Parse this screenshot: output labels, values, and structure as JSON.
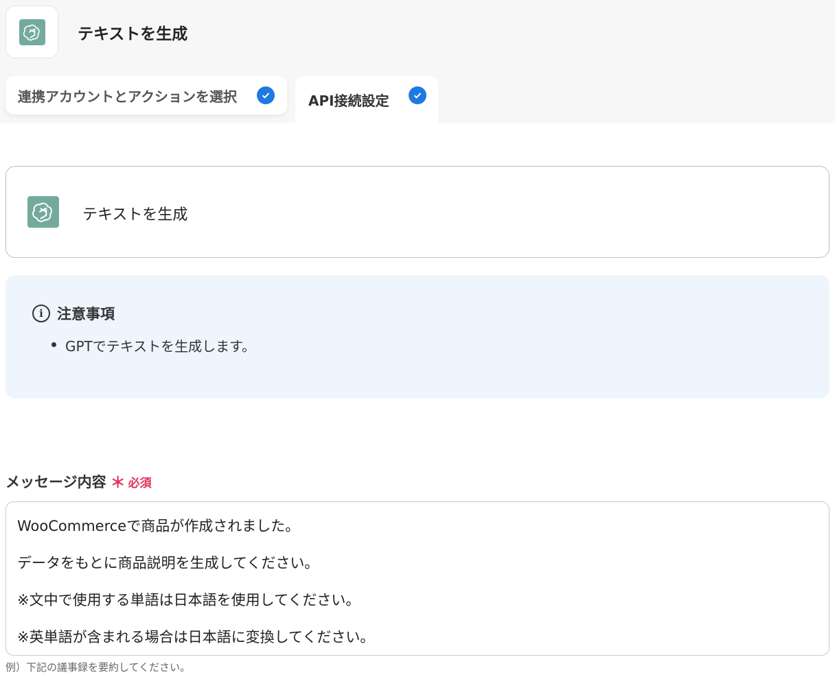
{
  "header": {
    "title": "テキストを生成",
    "icon": "chatgpt-logo-icon",
    "brand_color": "#74aa9c"
  },
  "tabs": [
    {
      "label": "連携アカウントとアクションを選択",
      "completed": true
    },
    {
      "label": "API接続設定",
      "completed": true,
      "active": true
    }
  ],
  "colors": {
    "check": "#1e7ae0",
    "required": "#e0335b",
    "notice_bg": "#eef5fd"
  },
  "action_card": {
    "title": "テキストを生成"
  },
  "notice": {
    "heading": "注意事項",
    "items": [
      "GPTでテキストを生成します。"
    ]
  },
  "message_field": {
    "label": "メッセージ内容",
    "required_mark": "＊",
    "required_text": "必須",
    "lines": [
      "WooCommerceで商品が作成されました。",
      "データをもとに商品説明を生成してください。",
      "※文中で使用する単語は日本語を使用してください。",
      "※英単語が含まれる場合は日本語に変換してください。"
    ],
    "hint": "例）下記の議事録を要約してください。"
  }
}
